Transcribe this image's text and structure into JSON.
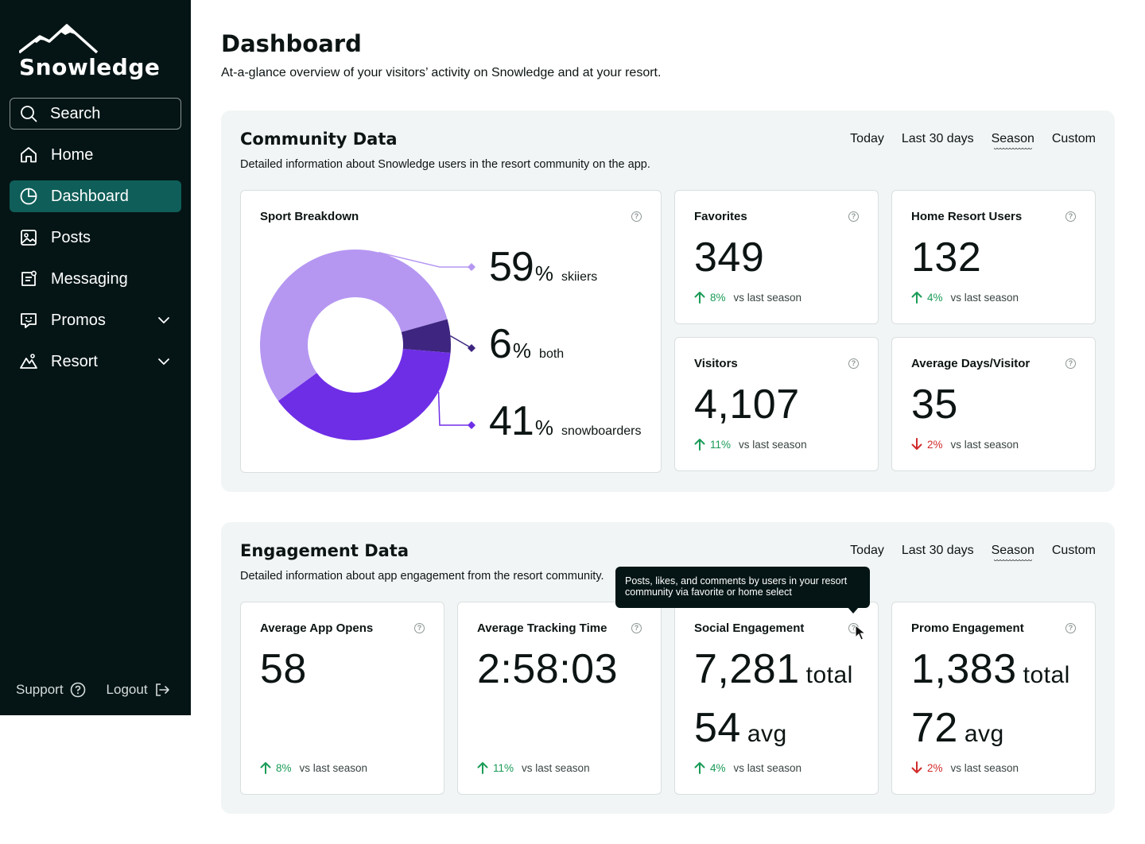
{
  "brand": {
    "name": "Snowledge"
  },
  "search": {
    "placeholder": "Search"
  },
  "nav": [
    {
      "label": "Home",
      "icon": "home-icon"
    },
    {
      "label": "Dashboard",
      "icon": "pie-chart-icon",
      "active": true
    },
    {
      "label": "Posts",
      "icon": "image-icon"
    },
    {
      "label": "Messaging",
      "icon": "message-icon"
    },
    {
      "label": "Promos",
      "icon": "chat-smile-icon",
      "expandable": true
    },
    {
      "label": "Resort",
      "icon": "mountain-icon",
      "expandable": true
    }
  ],
  "footer": {
    "support": "Support",
    "logout": "Logout"
  },
  "page": {
    "title": "Dashboard",
    "subtitle": "At-a-glance overview of your visitors’ activity on Snowledge and at your resort."
  },
  "range_options": [
    "Today",
    "Last 30 days",
    "Season",
    "Custom"
  ],
  "range_selected": "Season",
  "community": {
    "title": "Community Data",
    "subtitle": "Detailed information about Snowledge users in the resort community on the app.",
    "sport_breakdown": {
      "title": "Sport Breakdown",
      "slices": [
        {
          "name": "skiiers",
          "value": 59,
          "color": "#b597f2"
        },
        {
          "name": "both",
          "value": 6,
          "color": "#3e2580"
        },
        {
          "name": "snowboarders",
          "value": 41,
          "color": "#6e2ee6"
        }
      ],
      "pct": "%"
    },
    "favorites": {
      "title": "Favorites",
      "value": "349",
      "delta": "8%",
      "direction": "up",
      "vs": "vs last season"
    },
    "home_resort_users": {
      "title": "Home Resort Users",
      "value": "132",
      "delta": "4%",
      "direction": "up",
      "vs": "vs last season"
    },
    "visitors": {
      "title": "Visitors",
      "value": "4,107",
      "delta": "11%",
      "direction": "up",
      "vs": "vs last season"
    },
    "avg_days": {
      "title": "Average Days/Visitor",
      "value": "35",
      "delta": "2%",
      "direction": "down",
      "vs": "vs last season"
    }
  },
  "engagement": {
    "title": "Engagement Data",
    "subtitle": "Detailed information about app engagement from the resort community.",
    "app_opens": {
      "title": "Average App Opens",
      "value": "58",
      "delta": "8%",
      "direction": "up",
      "vs": "vs last season"
    },
    "tracking_time": {
      "title": "Average Tracking Time",
      "value": "2:58:03",
      "delta": "11%",
      "direction": "up",
      "vs": "vs last season"
    },
    "social": {
      "title": "Social Engagement",
      "total": "7,281",
      "total_unit": "total",
      "avg": "54",
      "avg_unit": "avg",
      "delta": "4%",
      "direction": "up",
      "vs": "vs last season"
    },
    "promo": {
      "title": "Promo Engagement",
      "total": "1,383",
      "total_unit": "total",
      "avg": "72",
      "avg_unit": "avg",
      "delta": "2%",
      "direction": "down",
      "vs": "vs last season"
    }
  },
  "tooltip": {
    "text": "Posts, likes, and comments by users in your resort community via favorite or home select"
  },
  "colors": {
    "sidebar_bg": "#051515",
    "active_nav": "#0f5e59",
    "up": "#1a9b57",
    "down": "#d12a2a",
    "panel_bg": "#f2f5f5"
  }
}
